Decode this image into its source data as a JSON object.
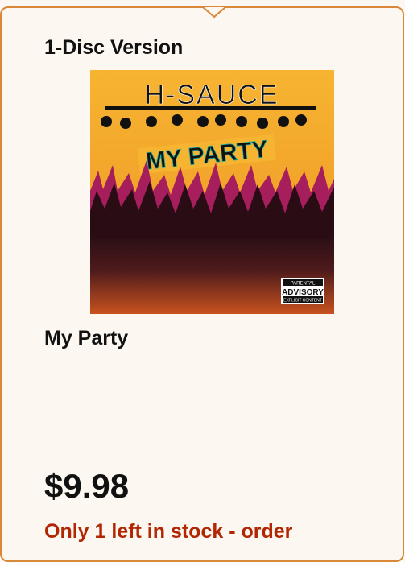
{
  "format": {
    "title": "1-Disc Version"
  },
  "album": {
    "artist": "H-SAUCE",
    "title_art": "MY PARTY",
    "advisory_line1": "PARENTAL",
    "advisory_line2": "ADVISORY",
    "advisory_line3": "EXPLICIT CONTENT"
  },
  "product": {
    "title": "My Party"
  },
  "price": "$9.98",
  "stock_message": "Only 1 left in stock - order",
  "colors": {
    "border": "#d9883a",
    "background": "#fcf7f0",
    "stock_text": "#b12704",
    "art_yellow": "#f7b22a",
    "art_magenta": "#a61e5c"
  }
}
